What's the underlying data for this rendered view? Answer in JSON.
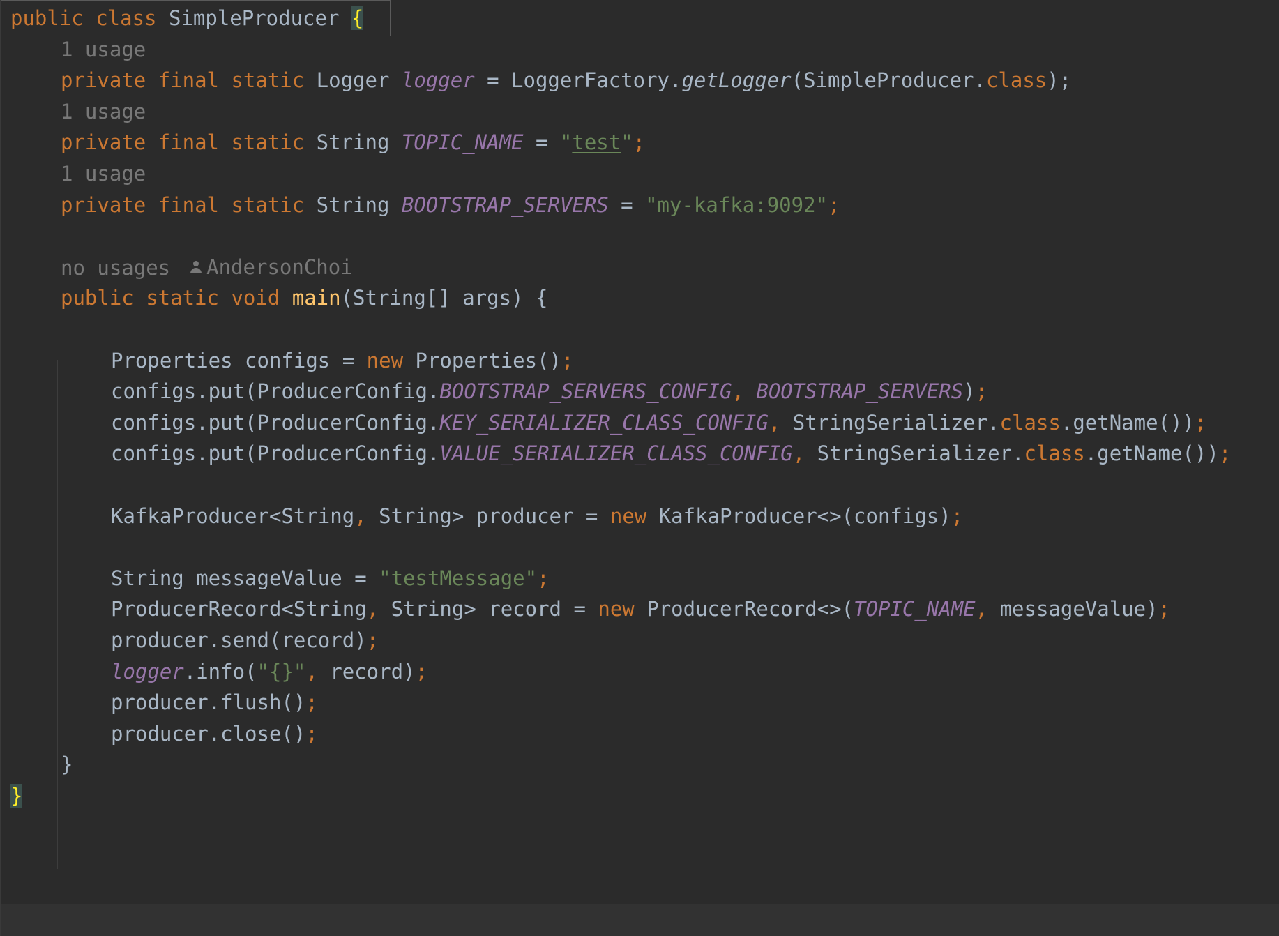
{
  "editor": {
    "lines": [
      {
        "id": "class-decl",
        "tokens": [
          {
            "t": "public ",
            "c": "kw"
          },
          {
            "t": "class ",
            "c": "kw"
          },
          {
            "t": "SimpleProducer ",
            "c": "plain"
          },
          {
            "t": "{",
            "c": "brace-hl"
          }
        ]
      },
      {
        "id": "hint-1",
        "hint": "1 usage"
      },
      {
        "id": "logger-decl",
        "tokens": [
          {
            "t": "private ",
            "c": "kw"
          },
          {
            "t": "final ",
            "c": "kw"
          },
          {
            "t": "static ",
            "c": "kw"
          },
          {
            "t": "Logger ",
            "c": "plain"
          },
          {
            "t": "logger",
            "c": "field"
          },
          {
            "t": " = LoggerFactory.",
            "c": "plain"
          },
          {
            "t": "getLogger",
            "c": "static-method"
          },
          {
            "t": "(SimpleProducer.",
            "c": "plain"
          },
          {
            "t": "class",
            "c": "kw"
          },
          {
            "t": ");",
            "c": "plain"
          }
        ]
      },
      {
        "id": "hint-2",
        "hint": "1 usage"
      },
      {
        "id": "topic-decl",
        "tokens": [
          {
            "t": "private ",
            "c": "kw"
          },
          {
            "t": "final ",
            "c": "kw"
          },
          {
            "t": "static ",
            "c": "kw"
          },
          {
            "t": "String ",
            "c": "plain"
          },
          {
            "t": "TOPIC_NAME",
            "c": "field"
          },
          {
            "t": " = ",
            "c": "plain"
          },
          {
            "t": "\"",
            "c": "str"
          },
          {
            "t": "test",
            "c": "str-u"
          },
          {
            "t": "\"",
            "c": "str"
          },
          {
            "t": ";",
            "c": "punct"
          }
        ]
      },
      {
        "id": "hint-3",
        "hint": "1 usage"
      },
      {
        "id": "bootstrap-decl",
        "tokens": [
          {
            "t": "private ",
            "c": "kw"
          },
          {
            "t": "final ",
            "c": "kw"
          },
          {
            "t": "static ",
            "c": "kw"
          },
          {
            "t": "String ",
            "c": "plain"
          },
          {
            "t": "BOOTSTRAP_SERVERS",
            "c": "field"
          },
          {
            "t": " = ",
            "c": "plain"
          },
          {
            "t": "\"my-kafka:9092\"",
            "c": "str"
          },
          {
            "t": ";",
            "c": "punct"
          }
        ]
      },
      {
        "id": "blank-1"
      },
      {
        "id": "hint-4",
        "hint": "no usages",
        "author": "AndersonChoi"
      },
      {
        "id": "main-decl",
        "tokens": [
          {
            "t": "public ",
            "c": "kw"
          },
          {
            "t": "static ",
            "c": "kw"
          },
          {
            "t": "void ",
            "c": "kw"
          },
          {
            "t": "main",
            "c": "method-decl"
          },
          {
            "t": "(String[] args) {",
            "c": "plain"
          }
        ]
      },
      {
        "id": "blank-2"
      },
      {
        "id": "props-new",
        "tokens": [
          {
            "t": "Properties configs = ",
            "c": "plain"
          },
          {
            "t": "new ",
            "c": "kw"
          },
          {
            "t": "Properties()",
            "c": "plain"
          },
          {
            "t": ";",
            "c": "punct"
          }
        ]
      },
      {
        "id": "put-bootstrap",
        "tokens": [
          {
            "t": "configs.put(ProducerConfig.",
            "c": "plain"
          },
          {
            "t": "BOOTSTRAP_SERVERS_CONFIG",
            "c": "field"
          },
          {
            "t": ", ",
            "c": "punct"
          },
          {
            "t": "BOOTSTRAP_SERVERS",
            "c": "field"
          },
          {
            "t": ")",
            "c": "plain"
          },
          {
            "t": ";",
            "c": "punct"
          }
        ]
      },
      {
        "id": "put-key",
        "tokens": [
          {
            "t": "configs.put(ProducerConfig.",
            "c": "plain"
          },
          {
            "t": "KEY_SERIALIZER_CLASS_CONFIG",
            "c": "field"
          },
          {
            "t": ", ",
            "c": "punct"
          },
          {
            "t": "StringSerializer.",
            "c": "plain"
          },
          {
            "t": "class",
            "c": "kw"
          },
          {
            "t": ".getName())",
            "c": "plain"
          },
          {
            "t": ";",
            "c": "punct"
          }
        ]
      },
      {
        "id": "put-value",
        "tokens": [
          {
            "t": "configs.put(ProducerConfig.",
            "c": "plain"
          },
          {
            "t": "VALUE_SERIALIZER_CLASS_CONFIG",
            "c": "field"
          },
          {
            "t": ", ",
            "c": "punct"
          },
          {
            "t": "StringSerializer.",
            "c": "plain"
          },
          {
            "t": "class",
            "c": "kw"
          },
          {
            "t": ".getName())",
            "c": "plain"
          },
          {
            "t": ";",
            "c": "punct"
          }
        ]
      },
      {
        "id": "blank-3"
      },
      {
        "id": "producer-new",
        "tokens": [
          {
            "t": "KafkaProducer<String",
            "c": "plain"
          },
          {
            "t": ", ",
            "c": "punct"
          },
          {
            "t": "String> producer = ",
            "c": "plain"
          },
          {
            "t": "new ",
            "c": "kw"
          },
          {
            "t": "KafkaProducer<>(configs)",
            "c": "plain"
          },
          {
            "t": ";",
            "c": "punct"
          }
        ]
      },
      {
        "id": "blank-4"
      },
      {
        "id": "message-value",
        "tokens": [
          {
            "t": "String messageValue = ",
            "c": "plain"
          },
          {
            "t": "\"testMessage\"",
            "c": "str"
          },
          {
            "t": ";",
            "c": "punct"
          }
        ]
      },
      {
        "id": "record-new",
        "tokens": [
          {
            "t": "ProducerRecord<String",
            "c": "plain"
          },
          {
            "t": ", ",
            "c": "punct"
          },
          {
            "t": "String> record = ",
            "c": "plain"
          },
          {
            "t": "new ",
            "c": "kw"
          },
          {
            "t": "ProducerRecord<>(",
            "c": "plain"
          },
          {
            "t": "TOPIC_NAME",
            "c": "field"
          },
          {
            "t": ", ",
            "c": "punct"
          },
          {
            "t": "messageValue)",
            "c": "plain"
          },
          {
            "t": ";",
            "c": "punct"
          }
        ]
      },
      {
        "id": "send",
        "tokens": [
          {
            "t": "producer.send(record)",
            "c": "plain"
          },
          {
            "t": ";",
            "c": "punct"
          }
        ]
      },
      {
        "id": "logger-info",
        "tokens": [
          {
            "t": "logger",
            "c": "field"
          },
          {
            "t": ".info(",
            "c": "plain"
          },
          {
            "t": "\"{}\"",
            "c": "str"
          },
          {
            "t": ", ",
            "c": "punct"
          },
          {
            "t": "record)",
            "c": "plain"
          },
          {
            "t": ";",
            "c": "punct"
          }
        ]
      },
      {
        "id": "flush",
        "tokens": [
          {
            "t": "producer.flush()",
            "c": "plain"
          },
          {
            "t": ";",
            "c": "punct"
          }
        ]
      },
      {
        "id": "close",
        "tokens": [
          {
            "t": "producer.close()",
            "c": "plain"
          },
          {
            "t": ";",
            "c": "punct"
          }
        ]
      },
      {
        "id": "main-close",
        "tokens": [
          {
            "t": "}",
            "c": "plain"
          }
        ]
      },
      {
        "id": "class-close",
        "tokens": [
          {
            "t": "}",
            "c": "brace-hl-y"
          }
        ]
      }
    ]
  },
  "colors": {
    "background": "#2b2b2b",
    "keyword": "#cc7832",
    "text": "#a9b7c6",
    "field": "#9876aa",
    "string": "#6a8759",
    "method_decl": "#ffc66d",
    "hint": "#787878",
    "brace_highlight": "#ffef28"
  }
}
